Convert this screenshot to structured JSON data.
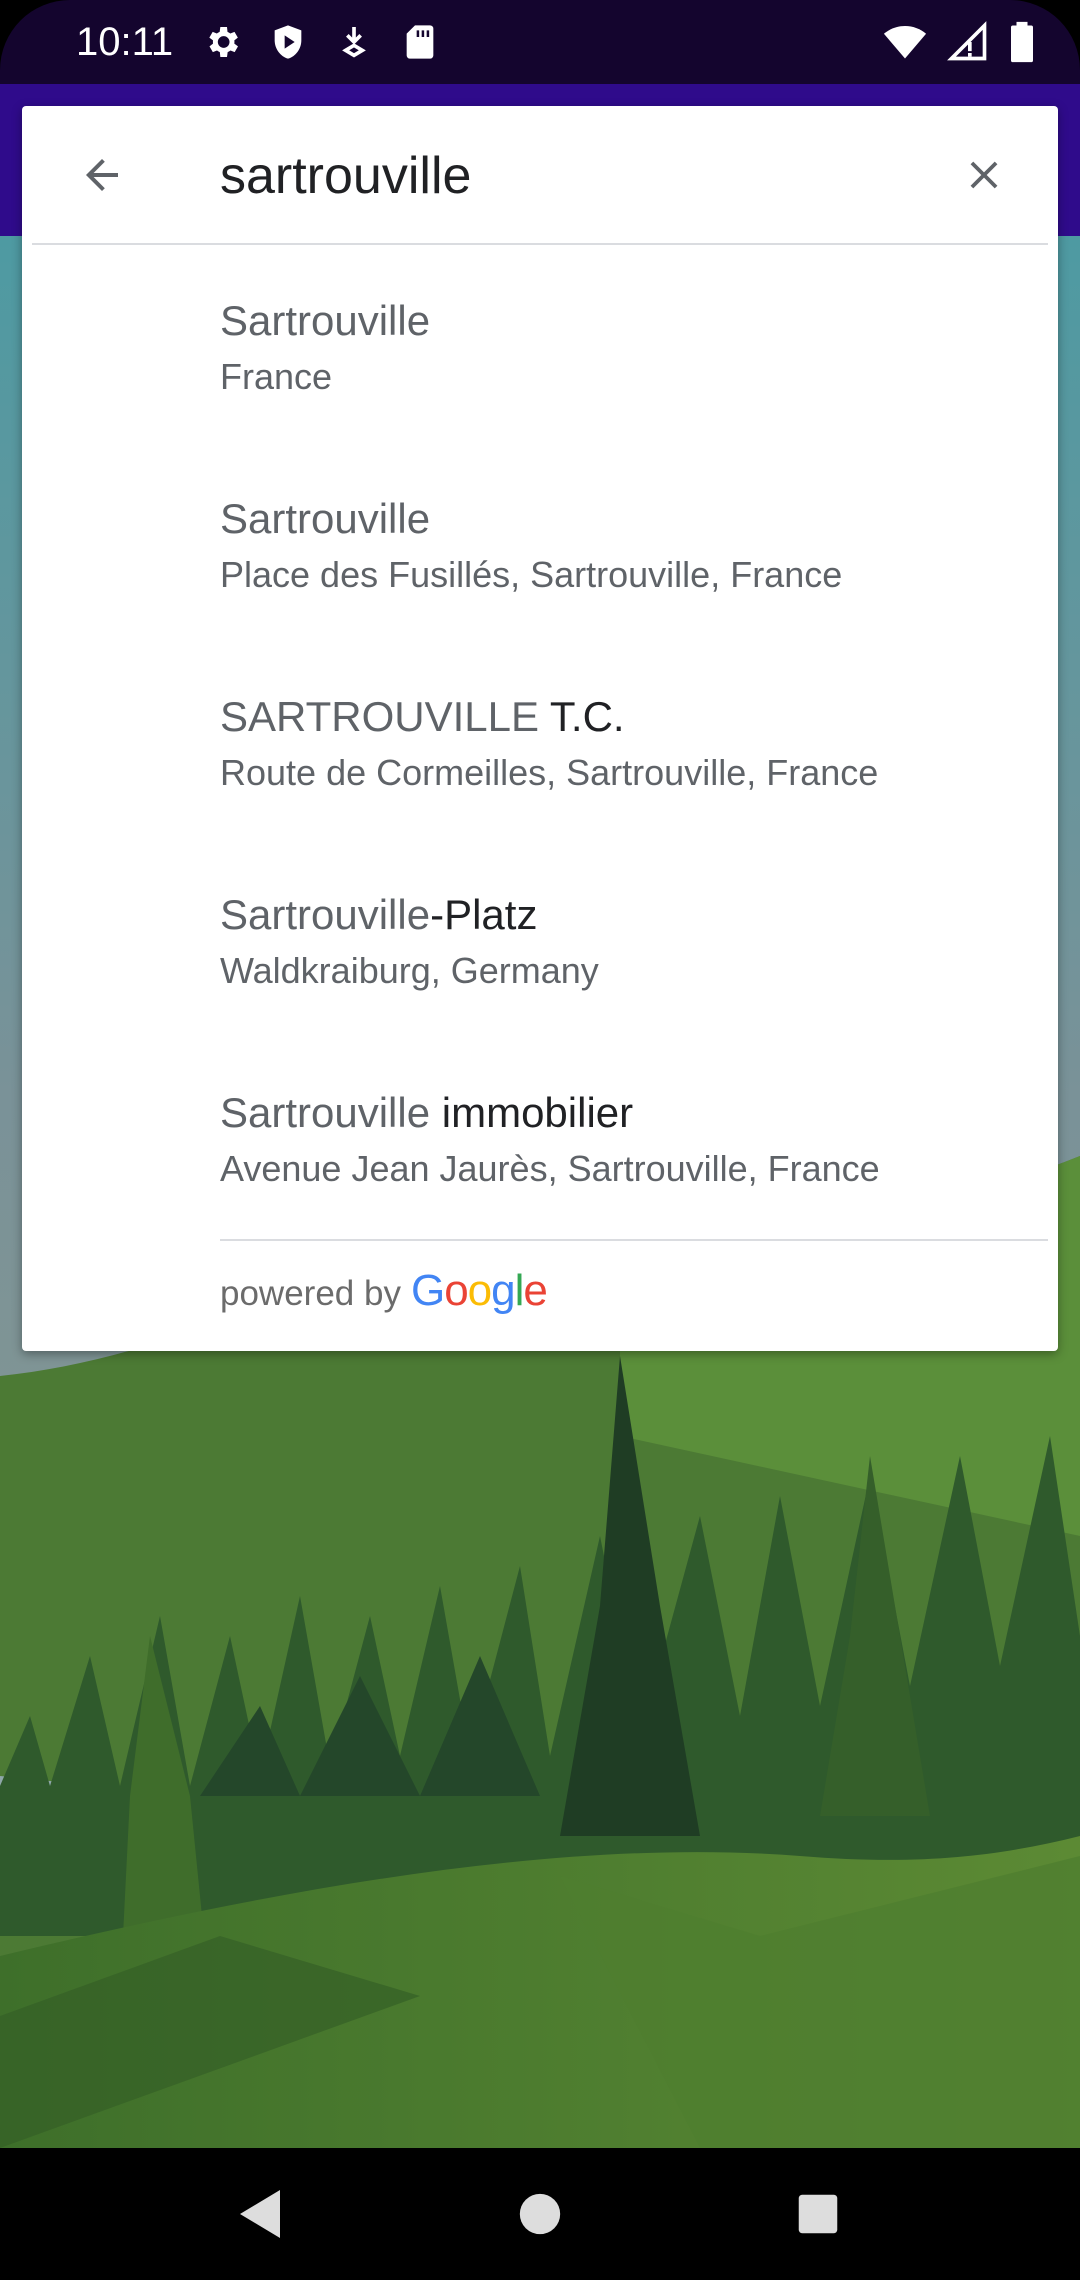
{
  "status_bar": {
    "time": "10:11",
    "left_icons": [
      "settings-icon",
      "shield-icon",
      "download-icon",
      "sd-card-icon"
    ],
    "right_icons": [
      "wifi-icon",
      "signal-icon",
      "battery-icon"
    ]
  },
  "search": {
    "query": "sartrouville"
  },
  "results": [
    {
      "title_plain": "Sartrouville",
      "title_bold": "",
      "subtitle": "France"
    },
    {
      "title_plain": "Sartrouville",
      "title_bold": "",
      "subtitle": "Place des Fusillés, Sartrouville, France"
    },
    {
      "title_plain": "SARTROUVILLE",
      "title_bold": " T.C.",
      "subtitle": "Route de Cormeilles, Sartrouville, France"
    },
    {
      "title_plain": "Sartrouville",
      "title_bold": "-Platz",
      "subtitle": "Waldkraiburg, Germany"
    },
    {
      "title_plain": "Sartrouville",
      "title_bold": " immobilier",
      "subtitle": "Avenue Jean Jaurès, Sartrouville, France"
    }
  ],
  "attribution": {
    "powered_by": "powered by",
    "logo_letters": [
      "G",
      "o",
      "o",
      "g",
      "l",
      "e"
    ],
    "logo_colors": [
      "#4285F4",
      "#EA4335",
      "#FBBC05",
      "#4285F4",
      "#34A853",
      "#EA4335"
    ]
  },
  "colors": {
    "status_bar_bg": "#14052e",
    "app_bar_bg": "#2f0b8b"
  },
  "navigation": [
    "back-icon",
    "home-icon",
    "recents-icon"
  ]
}
